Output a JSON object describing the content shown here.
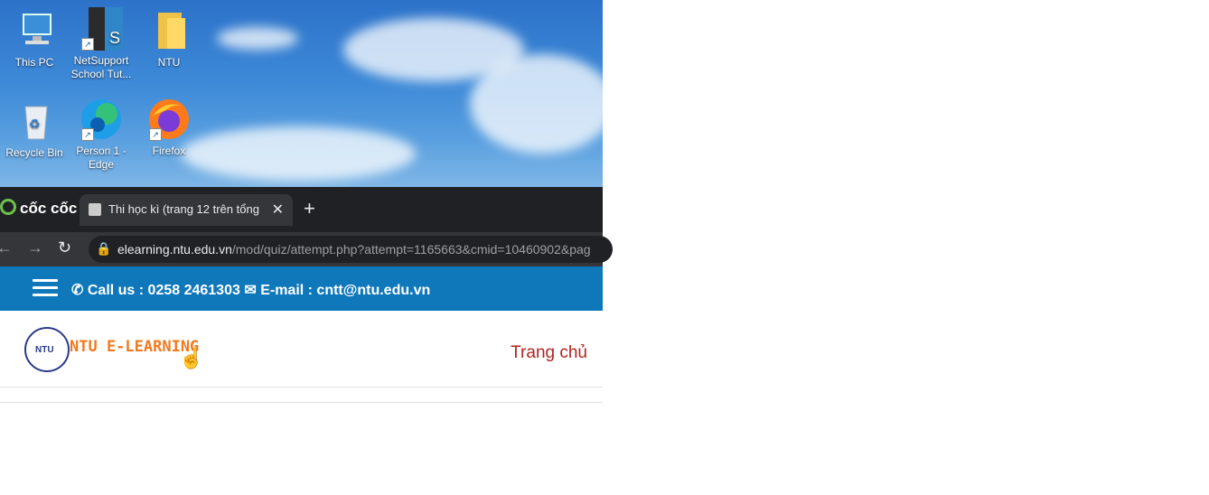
{
  "desktop": {
    "icons": [
      {
        "label": "This PC",
        "icon": "computer-icon"
      },
      {
        "label": "NetSupport School Tut...",
        "icon": "netsupport-icon"
      },
      {
        "label": "NTU",
        "icon": "folder-icon"
      },
      {
        "label": "Recycle Bin",
        "icon": "recycle-bin-icon"
      },
      {
        "label": "Person 1 - Edge",
        "icon": "edge-icon"
      },
      {
        "label": "Firefox",
        "icon": "firefox-icon"
      }
    ]
  },
  "browser": {
    "brand": "cốc cốc",
    "tab": {
      "title": "Thi học kì (trang 12 trên tổng"
    },
    "url": {
      "host": "elearning.ntu.edu.vn",
      "path": "/mod/quiz/attempt.php?attempt=1165663&cmid=10460902&pag"
    }
  },
  "site": {
    "contact": "Call us : 0258 2461303",
    "email": "E-mail : cntt@ntu.edu.vn",
    "logo_text": "NTU E-LEARNING",
    "logo_badge": "NTU",
    "nav_home": "Trang chủ"
  },
  "colors": {
    "topbar": "#0f78ba",
    "logo_orange": "#f07a1f",
    "home_link": "#b22222"
  }
}
